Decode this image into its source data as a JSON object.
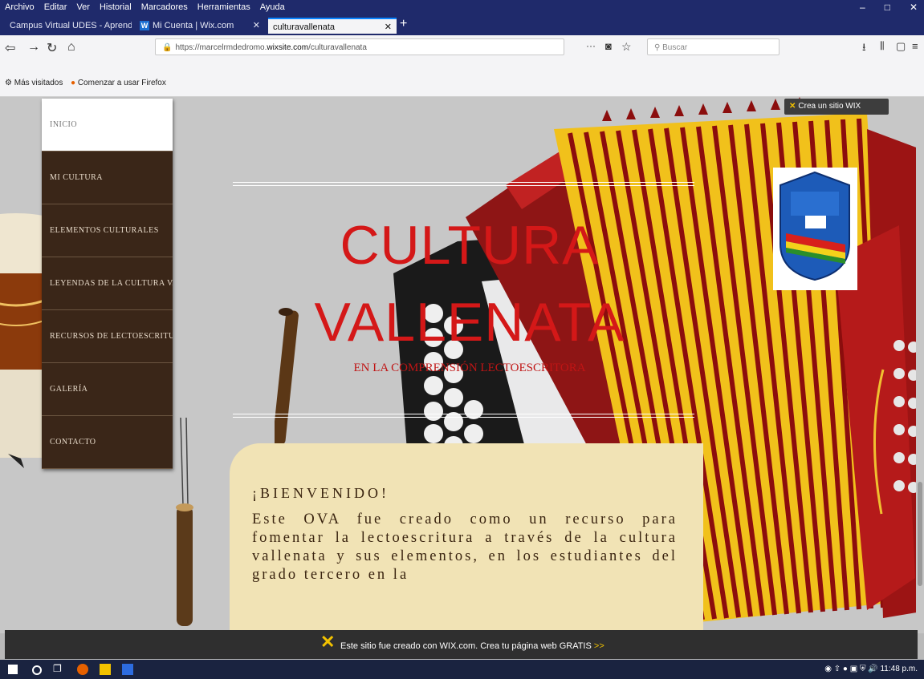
{
  "menubar": {
    "items": [
      "Archivo",
      "Editar",
      "Ver",
      "Historial",
      "Marcadores",
      "Herramientas",
      "Ayuda"
    ]
  },
  "tabs": [
    {
      "label": "Campus Virtual UDES - Aprendiame ×"
    },
    {
      "label": "Mi Cuenta | Wix.com"
    },
    {
      "label": "culturavallenata"
    }
  ],
  "navbar": {
    "url_prefix": "https://marcelrmdedromo.",
    "url_domain": "wixsite.com",
    "url_suffix": "/culturavallenata",
    "search_placeholder": "Buscar"
  },
  "bookmarks": {
    "most_visited": "Más visitados",
    "getting_started": "Comenzar a usar Firefox"
  },
  "wix_badge": {
    "label": "Crea un sitio WIX"
  },
  "sidebar": {
    "items": [
      {
        "label": "INICIO"
      },
      {
        "label": "MI CULTURA"
      },
      {
        "label": "ELEMENTOS CULTURALES"
      },
      {
        "label": "LEYENDAS DE LA CULTURA VALLENATA"
      },
      {
        "label": "RECURSOS DE LECTOESCRITURA"
      },
      {
        "label": "GALERÍA"
      },
      {
        "label": "CONTACTO"
      }
    ]
  },
  "hero": {
    "title_line1": "CULTURA",
    "title_line2": "VALLENATA",
    "subtitle": "EN LA COMPRENSIÓN LECTOESCRITORA"
  },
  "welcome": {
    "heading": "¡BIENVENIDO!",
    "body": "Este OVA fue creado como un recurso para fomentar la lectoescritura a través de la cultura vallenata y sus elementos, en los estudiantes del grado tercero en la"
  },
  "banner": {
    "text": "Este sitio fue creado con WIX.com. Crea tu página web GRATIS",
    "cta": ">>"
  },
  "taskbar": {
    "clock": "11:48 p.m."
  }
}
